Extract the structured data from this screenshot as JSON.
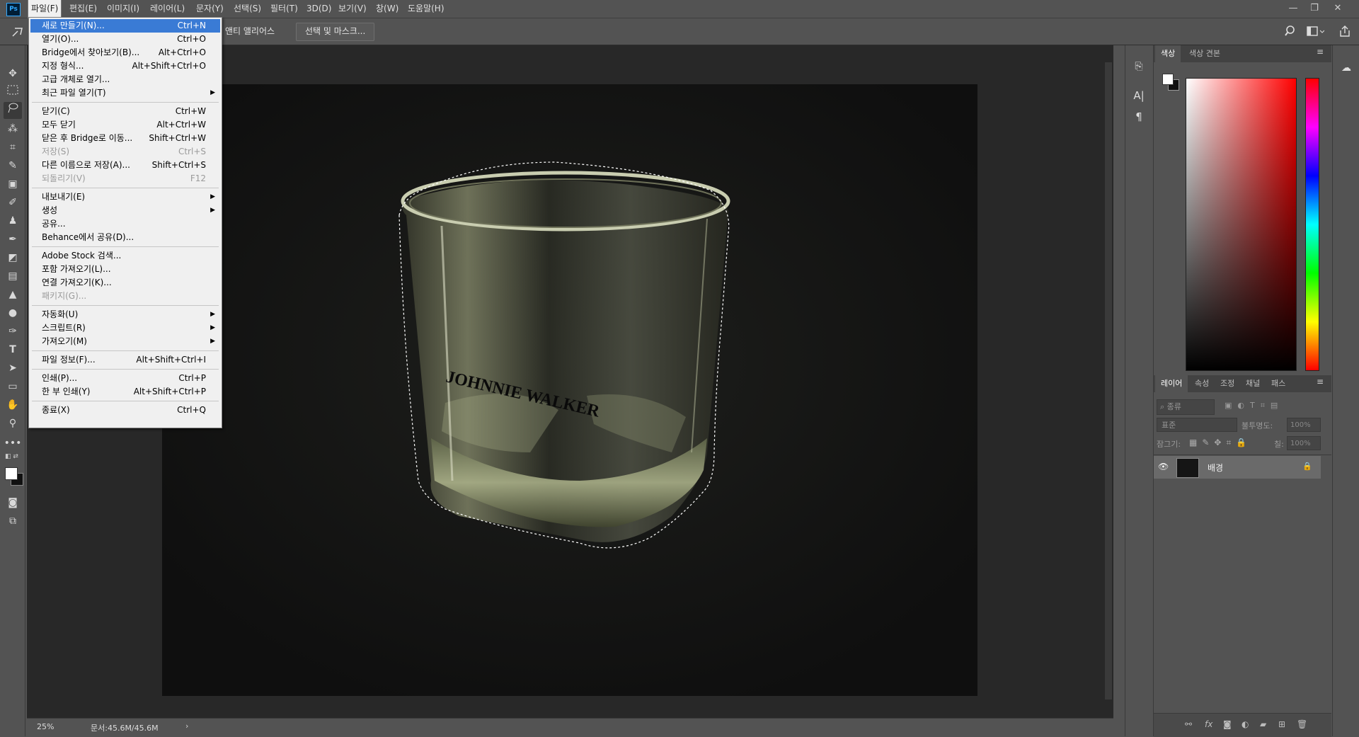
{
  "app": {
    "logo": "Ps"
  },
  "menubar": {
    "items": [
      "파일(F)",
      "편집(E)",
      "이미지(I)",
      "레이어(L)",
      "문자(Y)",
      "선택(S)",
      "필터(T)",
      "3D(D)",
      "보기(V)",
      "창(W)",
      "도움말(H)"
    ],
    "window_controls": {
      "minimize": "—",
      "restore": "❐",
      "close": "✕"
    }
  },
  "options_bar": {
    "antialias_label": "앤티 앨리어스",
    "select_mask_button": "선택 및 마스크..."
  },
  "file_menu": {
    "items": [
      {
        "label": "새로 만들기(N)...",
        "shortcut": "Ctrl+N"
      },
      {
        "label": "열기(O)...",
        "shortcut": "Ctrl+O"
      },
      {
        "label": "Bridge에서 찾아보기(B)...",
        "shortcut": "Alt+Ctrl+O"
      },
      {
        "label": "지정 형식...",
        "shortcut": "Alt+Shift+Ctrl+O"
      },
      {
        "label": "고급 개체로 열기...",
        "shortcut": ""
      },
      {
        "label": "최근 파일 열기(T)",
        "shortcut": ""
      },
      {
        "label": "닫기(C)",
        "shortcut": "Ctrl+W"
      },
      {
        "label": "모두 닫기",
        "shortcut": "Alt+Ctrl+W"
      },
      {
        "label": "닫은 후 Bridge로 이동...",
        "shortcut": "Shift+Ctrl+W"
      },
      {
        "label": "저장(S)",
        "shortcut": "Ctrl+S"
      },
      {
        "label": "다른 이름으로 저장(A)...",
        "shortcut": "Shift+Ctrl+S"
      },
      {
        "label": "되돌리기(V)",
        "shortcut": "F12"
      },
      {
        "label": "내보내기(E)",
        "shortcut": ""
      },
      {
        "label": "생성",
        "shortcut": ""
      },
      {
        "label": "공유...",
        "shortcut": ""
      },
      {
        "label": "Behance에서 공유(D)...",
        "shortcut": ""
      },
      {
        "label": "Adobe Stock 검색...",
        "shortcut": ""
      },
      {
        "label": "포함 가져오기(L)...",
        "shortcut": ""
      },
      {
        "label": "연결 가져오기(K)...",
        "shortcut": ""
      },
      {
        "label": "패키지(G)...",
        "shortcut": ""
      },
      {
        "label": "자동화(U)",
        "shortcut": ""
      },
      {
        "label": "스크립트(R)",
        "shortcut": ""
      },
      {
        "label": "가져오기(M)",
        "shortcut": ""
      },
      {
        "label": "파일 정보(F)...",
        "shortcut": "Alt+Shift+Ctrl+I"
      },
      {
        "label": "인쇄(P)...",
        "shortcut": "Ctrl+P"
      },
      {
        "label": "한 부 인쇄(Y)",
        "shortcut": "Alt+Shift+Ctrl+P"
      },
      {
        "label": "종료(X)",
        "shortcut": "Ctrl+Q"
      }
    ]
  },
  "canvas": {
    "brand_text": "JOHNNIE WALKER"
  },
  "statusbar": {
    "zoom": "25%",
    "doc_info": "문서:45.6M/45.6M"
  },
  "color_panel": {
    "tabs": [
      "색상",
      "색상 견본"
    ]
  },
  "layers_panel": {
    "tabs": [
      "레이어",
      "속성",
      "조정",
      "채널",
      "패스"
    ],
    "filter_placeholder": "종류",
    "blend_mode": "표준",
    "opacity_label": "불투명도:",
    "opacity_value": "100%",
    "lock_label": "잠그기:",
    "fill_label": "칠:",
    "fill_value": "100%",
    "layer_name": "배경"
  },
  "colors": {
    "accent": "#3a7bd5",
    "panel": "#535353",
    "docbg": "#282828"
  }
}
